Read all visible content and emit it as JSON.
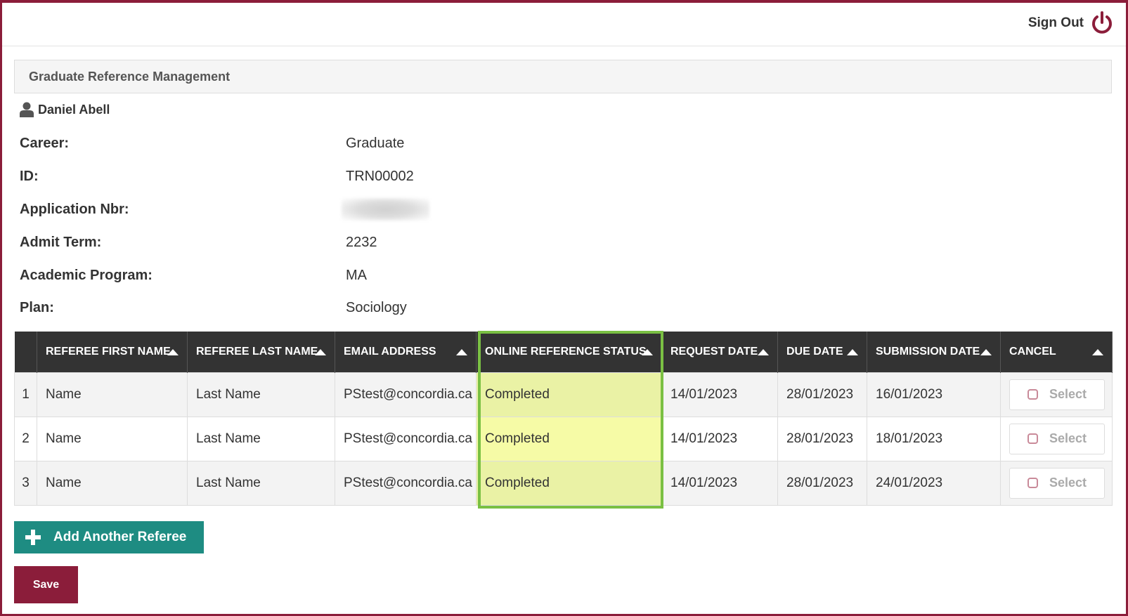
{
  "header": {
    "signout_label": "Sign Out",
    "signout_icon": "power-icon",
    "accent": "#8b1d3a"
  },
  "panel": {
    "title": "Graduate Reference Management"
  },
  "user": {
    "name": "Daniel Abell",
    "icon": "user-icon"
  },
  "info": {
    "career_label": "Career:",
    "career_value": "Graduate",
    "id_label": "ID:",
    "id_value": "TRN00002",
    "appnbr_label": "Application Nbr:",
    "appnbr_value": "",
    "admit_label": "Admit Term:",
    "admit_value": "2232",
    "program_label": "Academic Program:",
    "program_value": "MA",
    "plan_label": "Plan:",
    "plan_value": "Sociology"
  },
  "table": {
    "headers": {
      "first": "REFEREE FIRST NAME",
      "last": "REFEREE LAST NAME",
      "email": "EMAIL ADDRESS",
      "status": "ONLINE REFERENCE STATUS",
      "request": "REQUEST DATE",
      "due": "DUE DATE",
      "submission": "SUBMISSION DATE",
      "cancel": "CANCEL"
    },
    "select_label": "Select",
    "rows": [
      {
        "num": "1",
        "first": "Name",
        "last": "Last Name",
        "email": "PStest@concordia.ca",
        "status": "Completed",
        "request": "14/01/2023",
        "due": "28/01/2023",
        "submission": "16/01/2023"
      },
      {
        "num": "2",
        "first": "Name",
        "last": "Last Name",
        "email": "PStest@concordia.ca",
        "status": "Completed",
        "request": "14/01/2023",
        "due": "28/01/2023",
        "submission": "18/01/2023"
      },
      {
        "num": "3",
        "first": "Name",
        "last": "Last Name",
        "email": "PStest@concordia.ca",
        "status": "Completed",
        "request": "14/01/2023",
        "due": "28/01/2023",
        "submission": "24/01/2023"
      }
    ]
  },
  "actions": {
    "add_label": "Add Another Referee",
    "save_label": "Save"
  }
}
